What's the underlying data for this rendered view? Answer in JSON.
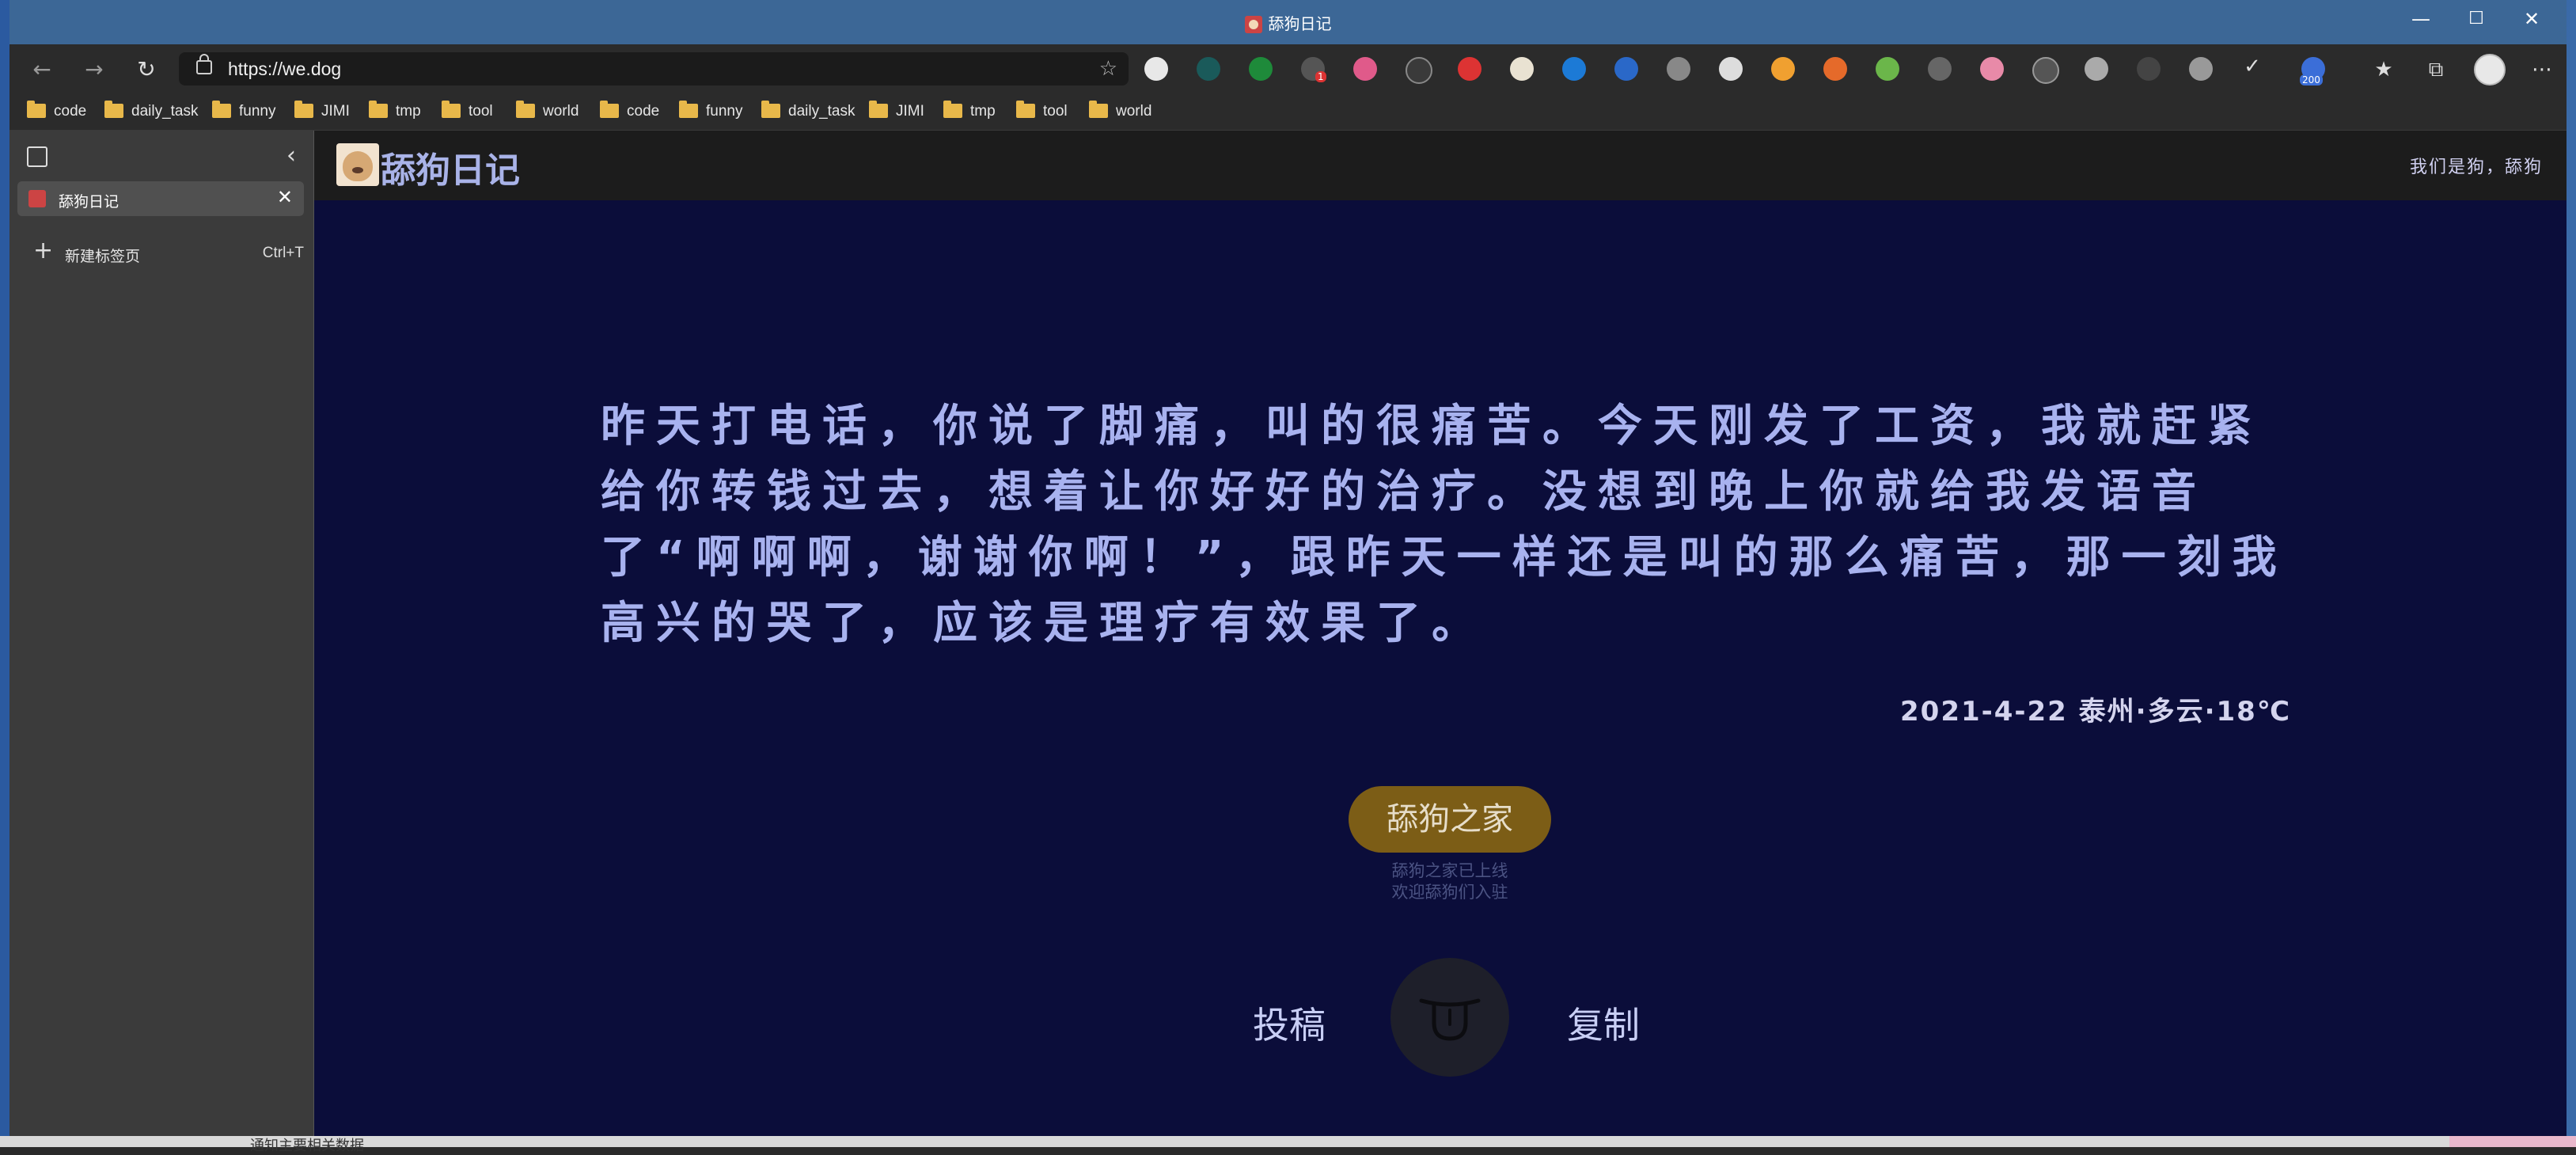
{
  "browser": {
    "window_title": "舔狗日记",
    "url": "https://we.dog",
    "bookmarks": [
      "code",
      "daily_task",
      "funny",
      "JIMI",
      "tmp",
      "tool",
      "world",
      "code",
      "funny",
      "daily_task",
      "JIMI",
      "tmp",
      "tool",
      "world"
    ],
    "extension_badges": {
      "ext4": "1",
      "ext23": "200"
    },
    "tabs": [
      {
        "label": "舔狗日记"
      }
    ],
    "new_tab_label": "新建标签页",
    "new_tab_shortcut": "Ctrl+T"
  },
  "site": {
    "logo_text": "舔狗日记",
    "slogan": "我们是狗，舔狗",
    "diary_text": "昨天打电话，你说了脚痛，叫的很痛苦。今天刚发了工资，我就赶紧给你转钱过去，想着让你好好的治疗。没想到晚上你就给我发语音了“啊啊啊，谢谢你啊！”，跟昨天一样还是叫的那么痛苦，那一刻我高兴的哭了，应该是理疗有效果了。",
    "meta": "2021-4-22  泰州·多云·18℃",
    "home_button": "舔狗之家",
    "notice_line1": "舔狗之家已上线",
    "notice_line2": "欢迎舔狗们入驻",
    "submit_label": "投稿",
    "copy_label": "复制"
  },
  "desktop": {
    "taskbar_text": "通知主要相关数据"
  },
  "colors": {
    "page_bg": "#0b0d3a",
    "text_accent": "#a8b2ef",
    "home_button_bg": "#7c5d16",
    "titlebar": "#3c6796"
  }
}
